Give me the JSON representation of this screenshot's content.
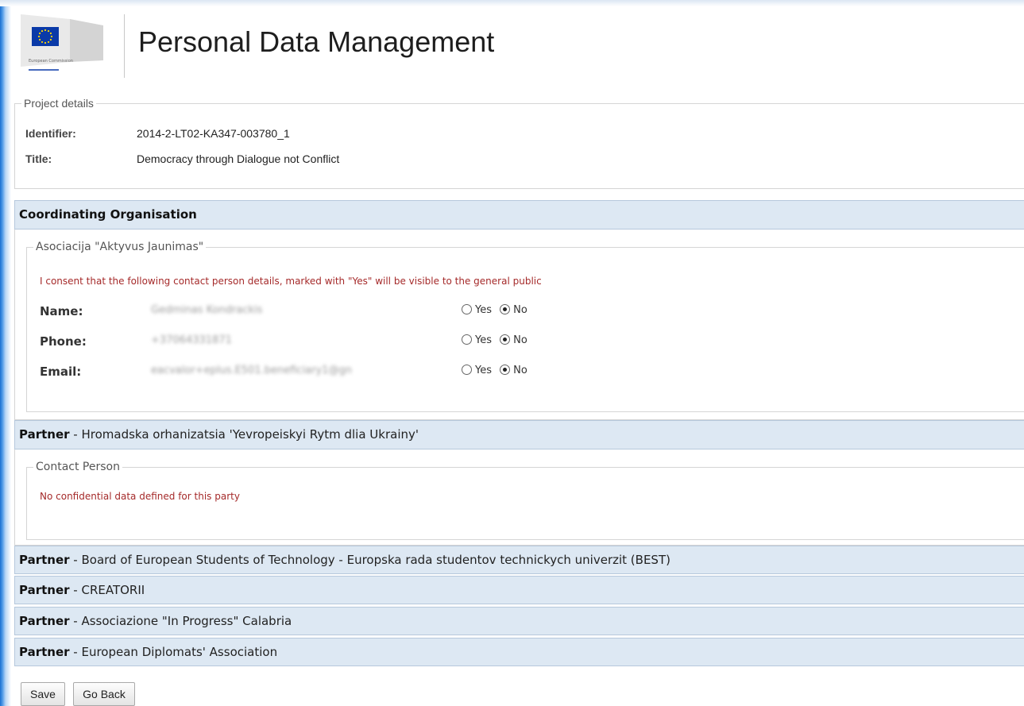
{
  "header": {
    "title": "Personal Data Management",
    "logo_text": "European Commission",
    "logo_colors": {
      "flag": "#0a3aa8",
      "star": "#ffd700"
    }
  },
  "project": {
    "legend": "Project details",
    "identifier_label": "Identifier:",
    "identifier": "2014-2-LT02-KA347-003780_1",
    "title_label": "Title:",
    "title": "Democracy through Dialogue not Conflict"
  },
  "coordinating": {
    "heading": "Coordinating Organisation",
    "org_name": "Asociacija \"Aktyvus Jaunimas\"",
    "consent_text": "I consent that the following contact person details, marked with \"Yes\" will be visible to the general public",
    "yes_label": "Yes",
    "no_label": "No",
    "rows": [
      {
        "label": "Name:",
        "value": "Gedminas Kondrackis",
        "selected": "No"
      },
      {
        "label": "Phone:",
        "value": "+37064331871",
        "selected": "No"
      },
      {
        "label": "Email:",
        "value": "eacvalor+eplus.E501.beneficiary1@gn",
        "selected": "No"
      }
    ]
  },
  "partners": [
    {
      "prefix": "Partner",
      "name": " - Hromadska orhanizatsia 'Yevropeiskyi Rytm dlia Ukrainy'",
      "expanded": true,
      "contact_legend": "Contact Person",
      "no_data_text": "No confidential data defined for this party"
    },
    {
      "prefix": "Partner",
      "name": " - Board of European Students of Technology - Europska rada studentov technickych univerzit (BEST)"
    },
    {
      "prefix": "Partner",
      "name": " - CREATORII"
    },
    {
      "prefix": "Partner",
      "name": " - Associazione \"In Progress\" Calabria"
    },
    {
      "prefix": "Partner",
      "name": " - European Diplomats' Association"
    }
  ],
  "buttons": {
    "save": "Save",
    "back": "Go Back"
  }
}
